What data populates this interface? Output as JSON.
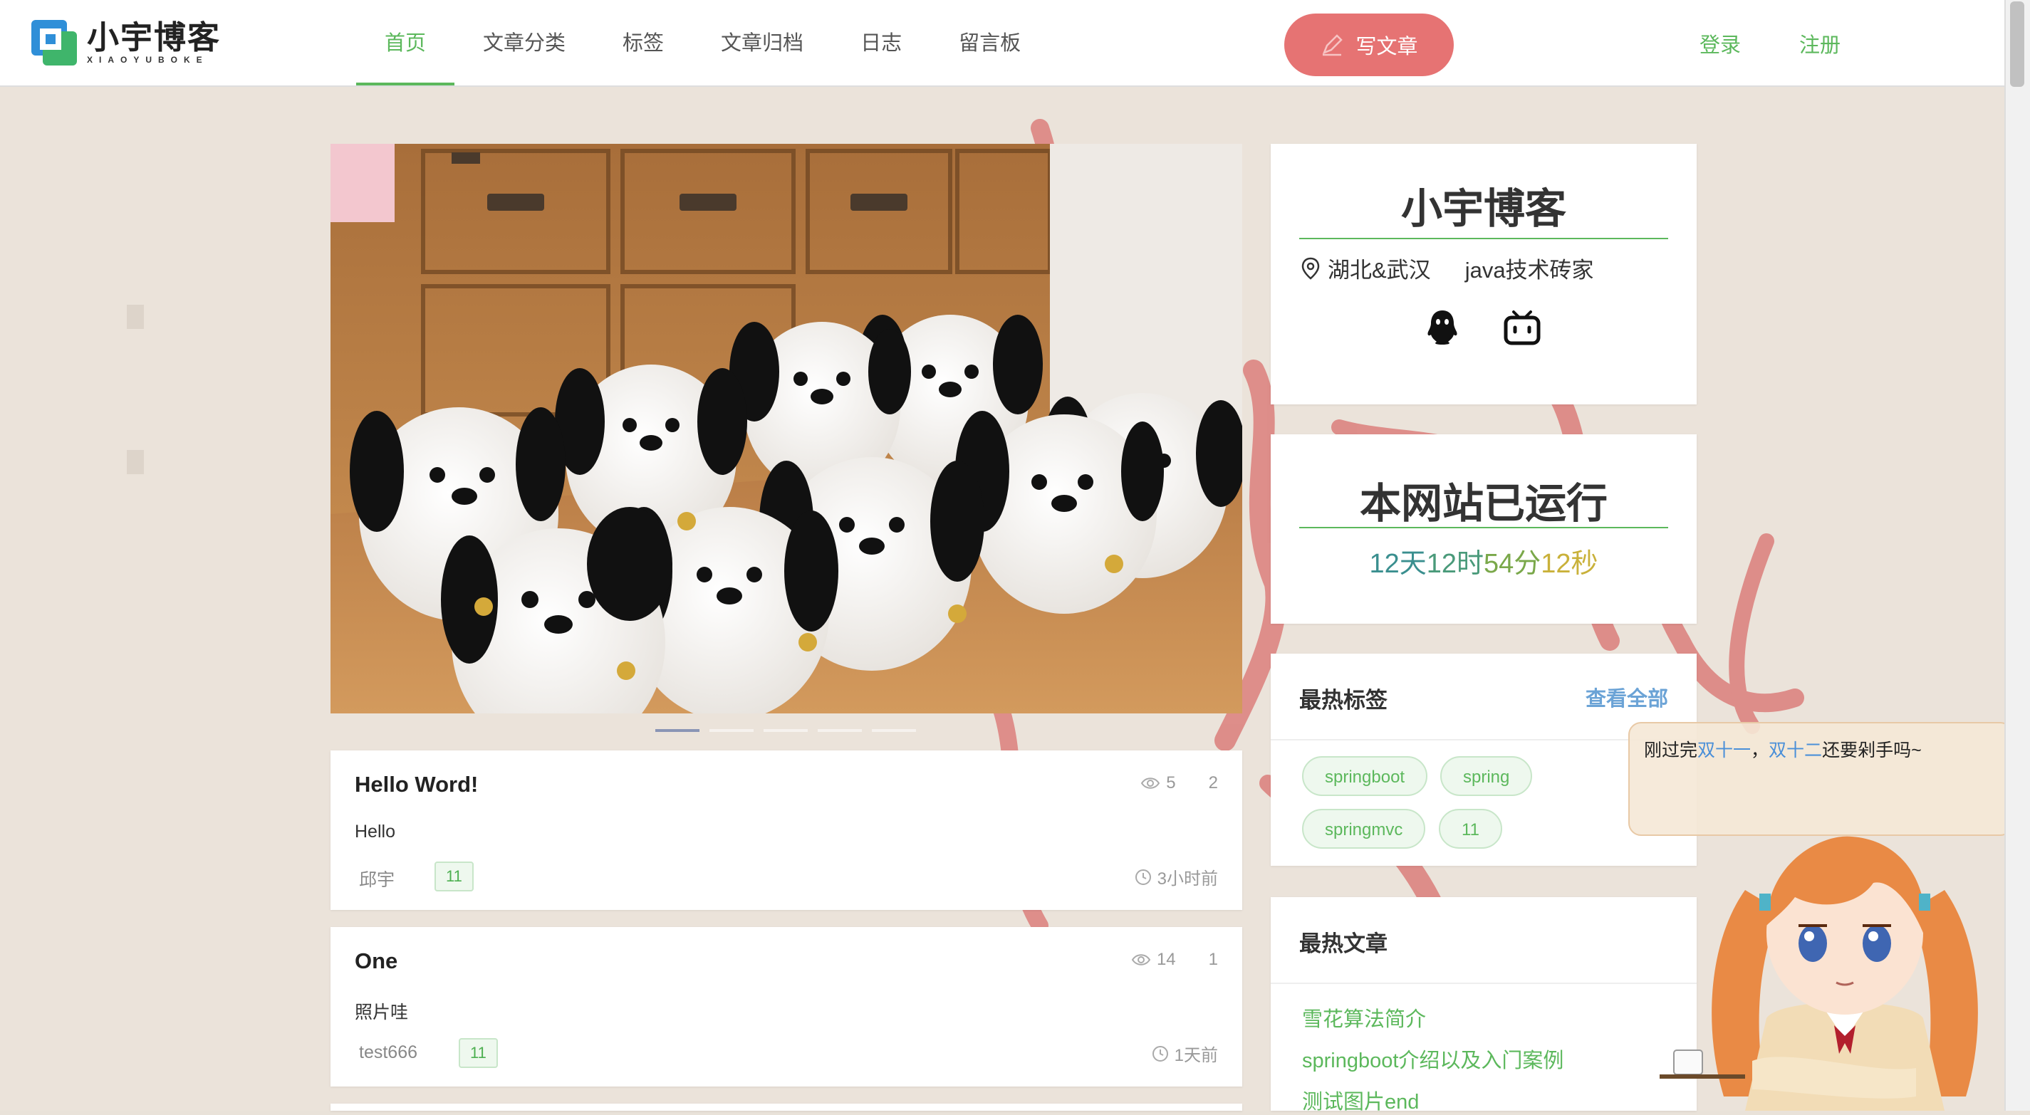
{
  "header": {
    "logo_title": "小宇博客",
    "logo_subtitle": "XIAOYUBOKE",
    "nav": [
      {
        "label": "首页",
        "active": true
      },
      {
        "label": "文章分类",
        "active": false
      },
      {
        "label": "标签",
        "active": false
      },
      {
        "label": "文章归档",
        "active": false
      },
      {
        "label": "日志",
        "active": false
      },
      {
        "label": "留言板",
        "active": false
      }
    ],
    "write_label": "写文章",
    "login_label": "登录",
    "register_label": "注册"
  },
  "carousel": {
    "slide_count": 5,
    "active_index": 0
  },
  "articles": [
    {
      "title": "Hello Word!",
      "excerpt": "Hello",
      "author": "邱宇",
      "tag": "11",
      "views": "5",
      "comments": "2",
      "time": "3小时前"
    },
    {
      "title": "One",
      "excerpt": "照片哇",
      "author": "test666",
      "tag": "11",
      "views": "14",
      "comments": "1",
      "time": "1天前"
    }
  ],
  "profile": {
    "name": "小宇博客",
    "location": "湖北&武汉",
    "title": "java技术砖家",
    "social_icons": [
      "qq-icon",
      "bilibili-icon"
    ]
  },
  "runtime": {
    "title": "本网站已运行",
    "parts": [
      "12天",
      "12时",
      "54分",
      "12秒"
    ],
    "colors": [
      "#3a8f8f",
      "#4a9a7a",
      "#7aa84a",
      "#c9b13a"
    ]
  },
  "hot_tags": {
    "title": "最热标签",
    "see_all": "查看全部",
    "tags": [
      "springboot",
      "spring",
      "springmvc",
      "11"
    ]
  },
  "hot_articles": {
    "title": "最热文章",
    "items": [
      "雪花算法简介",
      "springboot介绍以及入门案例",
      "测试图片end"
    ]
  },
  "mascot": {
    "speech_prefix": "刚过完",
    "speech_hl1": "双十一",
    "speech_sep": "，",
    "speech_hl2": "双十二",
    "speech_suffix": "还要剁手吗~"
  },
  "colors": {
    "accent": "#5cb85c",
    "write_button": "#e67373",
    "link_blue": "#6ba3d6"
  }
}
